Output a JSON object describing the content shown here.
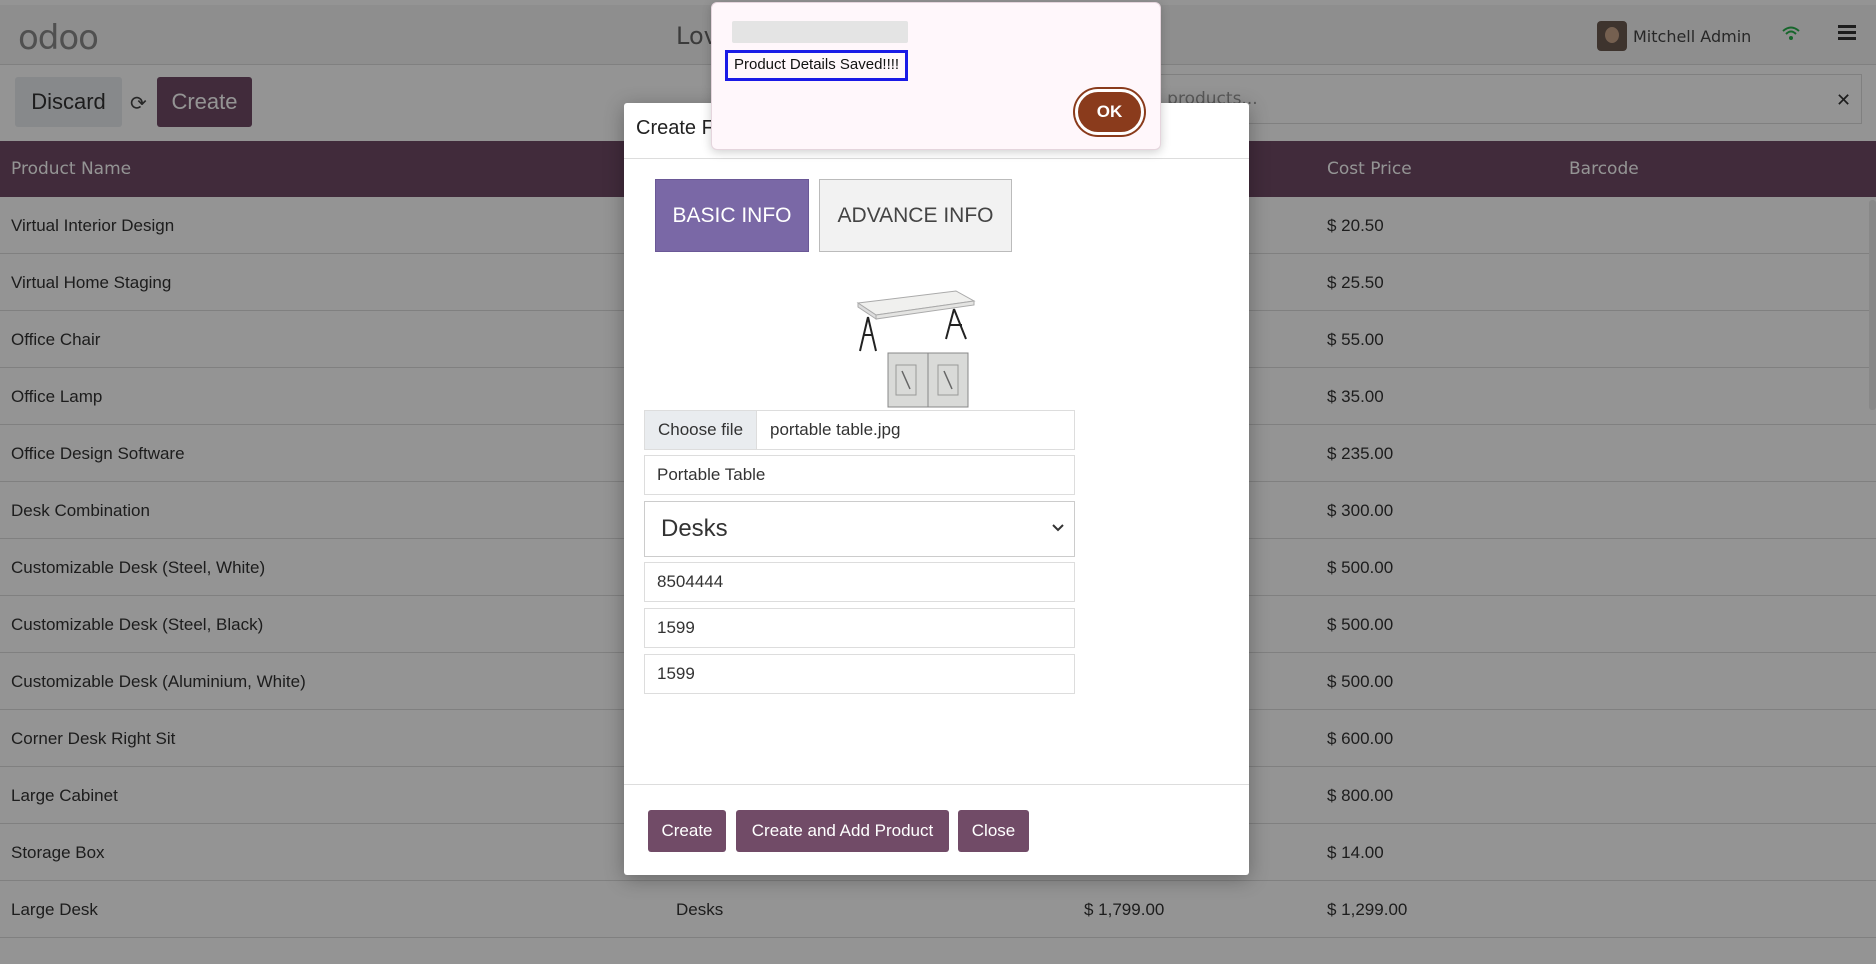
{
  "navbar": {
    "logo": "odoo",
    "title": "Lov",
    "user": "Mitchell Admin"
  },
  "toolbar": {
    "discard": "Discard",
    "create": "Create",
    "search_placeholder": "h products..."
  },
  "table": {
    "headers": [
      "Product Name",
      "Cost Price",
      "Barcode"
    ],
    "rows": [
      {
        "name": "Virtual Interior Design",
        "category": "",
        "price": "",
        "cost": "$ 20.50"
      },
      {
        "name": "Virtual Home Staging",
        "category": "",
        "price": "",
        "cost": "$ 25.50"
      },
      {
        "name": "Office Chair",
        "category": "",
        "price": "",
        "cost": "$ 55.00"
      },
      {
        "name": "Office Lamp",
        "category": "",
        "price": "",
        "cost": "$ 35.00"
      },
      {
        "name": "Office Design Software",
        "category": "",
        "price": "",
        "cost": "$ 235.00"
      },
      {
        "name": "Desk Combination",
        "category": "",
        "price": "",
        "cost": "$ 300.00"
      },
      {
        "name": "Customizable Desk (Steel, White)",
        "category": "",
        "price": "",
        "cost": "$ 500.00"
      },
      {
        "name": "Customizable Desk (Steel, Black)",
        "category": "",
        "price": "",
        "cost": "$ 500.00"
      },
      {
        "name": "Customizable Desk (Aluminium, White)",
        "category": "",
        "price": "",
        "cost": "$ 500.00"
      },
      {
        "name": "Corner Desk Right Sit",
        "category": "",
        "price": "",
        "cost": "$ 600.00"
      },
      {
        "name": "Large Cabinet",
        "category": "",
        "price": "",
        "cost": "$ 800.00"
      },
      {
        "name": "Storage Box",
        "category": "",
        "price": "",
        "cost": "$ 14.00"
      },
      {
        "name": "Large Desk",
        "category": "Desks",
        "price": "$ 1,799.00",
        "cost": "$ 1,299.00"
      }
    ]
  },
  "modal": {
    "title": "Create F",
    "tab_basic": "BASIC INFO",
    "tab_advance": "ADVANCE INFO",
    "choose_file": "Choose file",
    "file_name": "portable table.jpg",
    "product_name": "Portable Table",
    "category": "Desks",
    "barcode": "8504444",
    "price": "1599",
    "cost": "1599",
    "btn_create": "Create",
    "btn_create_add": "Create and Add Product",
    "btn_close": "Close"
  },
  "alert": {
    "message": "Product Details Saved!!!!",
    "ok": "OK"
  },
  "icons": {
    "refresh": "refresh-icon",
    "wifi": "wifi-icon",
    "menu": "hamburger-icon",
    "close": "close-icon",
    "chevron": "chevron-down-icon"
  },
  "colors": {
    "brand": "#714b67",
    "tab_active": "#7a68a6",
    "ok_button": "#8a3b1c"
  }
}
